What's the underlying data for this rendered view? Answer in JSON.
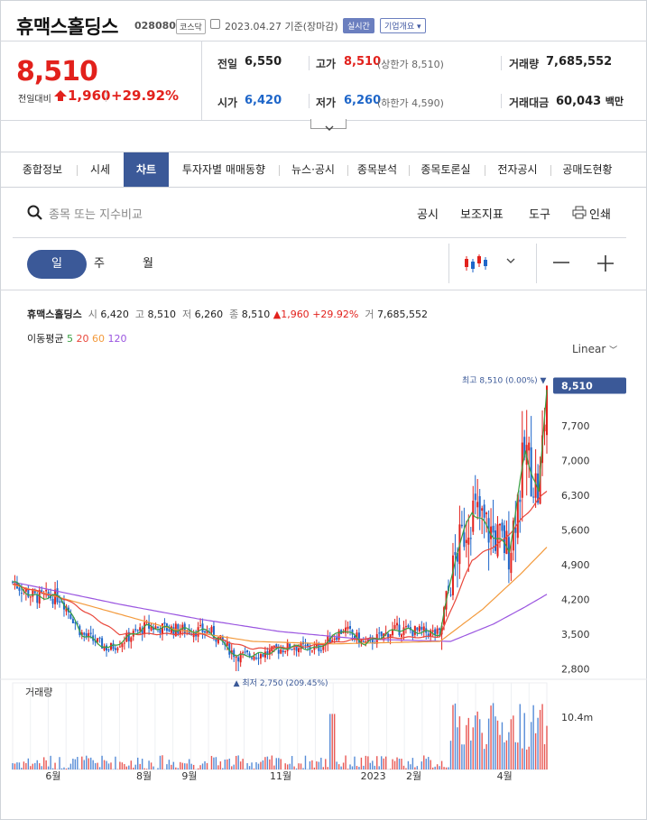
{
  "header": {
    "name": "휴맥스홀딩스",
    "code": "028080",
    "market": "코스닥",
    "date": "2023.04.27",
    "date_suffix": "기준(장마감)",
    "realtime": "실시간",
    "company_overview": "기업개요"
  },
  "price": {
    "current": "8,510",
    "change_label": "전일대비",
    "change": "1,960",
    "change_pct": "+29.92%"
  },
  "quote": {
    "prev_close_label": "전일",
    "prev_close": "6,550",
    "high_label": "고가",
    "high": "8,510",
    "upper_limit": "(상한가 8,510)",
    "volume_label": "거래량",
    "volume": "7,685,552",
    "open_label": "시가",
    "open": "6,420",
    "low_label": "저가",
    "low": "6,260",
    "lower_limit": "(하한가 4,590)",
    "amount_label": "거래대금",
    "amount": "60,043",
    "amount_unit": "백만"
  },
  "tabs": [
    "종합정보",
    "시세",
    "차트",
    "투자자별 매매동향",
    "뉴스·공시",
    "종목분석",
    "종목토론실",
    "전자공시",
    "공매도현황"
  ],
  "toolbar": {
    "search_placeholder": "종목 또는 지수비교",
    "disclosure": "공시",
    "indicator": "보조지표",
    "tools": "도구",
    "print": "인쇄"
  },
  "periods": [
    "일",
    "주",
    "월"
  ],
  "info": {
    "name": "휴맥스홀딩스",
    "open_lbl": "시",
    "open": "6,420",
    "high_lbl": "고",
    "high": "8,510",
    "low_lbl": "저",
    "low": "6,260",
    "close_lbl": "종",
    "close": "8,510",
    "change": "▲1,960",
    "pct": "+29.92%",
    "vol_lbl": "거",
    "vol": "7,685,552"
  },
  "ma": {
    "label": "이동평균",
    "p5": "5",
    "p20": "20",
    "p60": "60",
    "p120": "120"
  },
  "colors": {
    "up": "#e2211c",
    "down": "#1e66c9",
    "accent": "#3b5998",
    "ma5": "#3aa043",
    "ma20": "#e9473b",
    "ma60": "#f39a3c",
    "ma120": "#9a55e0"
  },
  "chart_data": {
    "type": "candlestick",
    "scale": "Linear",
    "y_ticks": [
      "7,700",
      "7,000",
      "6,300",
      "5,600",
      "4,900",
      "4,200",
      "3,500",
      "2,800"
    ],
    "y_tick_values": [
      7700,
      7000,
      6300,
      5600,
      4900,
      4200,
      3500,
      2800
    ],
    "ylim": [
      2550,
      8700
    ],
    "x_ticks": [
      "6월",
      "8월",
      "9월",
      "11월",
      "2023",
      "2월",
      "4월"
    ],
    "x_tick_positions": [
      0.075,
      0.245,
      0.33,
      0.495,
      0.665,
      0.75,
      0.92
    ],
    "current_label": "8,510",
    "current_value": 8510,
    "max_label": "최고 8,510 (0.00%)",
    "max_value": 8510,
    "min_label": "최저 2,750 (209.45%)",
    "min_value": 2750,
    "volume_label": "거래량",
    "volume_tick": "10.4m",
    "price_path_keypoints": [
      [
        0.0,
        4550
      ],
      [
        0.04,
        4250
      ],
      [
        0.09,
        4250
      ],
      [
        0.13,
        3500
      ],
      [
        0.18,
        3200
      ],
      [
        0.25,
        3650
      ],
      [
        0.3,
        3600
      ],
      [
        0.37,
        3550
      ],
      [
        0.42,
        3050
      ],
      [
        0.47,
        3100
      ],
      [
        0.52,
        3250
      ],
      [
        0.57,
        3200
      ],
      [
        0.62,
        3600
      ],
      [
        0.66,
        3300
      ],
      [
        0.72,
        3600
      ],
      [
        0.8,
        3500
      ],
      [
        0.83,
        5100
      ],
      [
        0.86,
        6000
      ],
      [
        0.9,
        5500
      ],
      [
        0.93,
        5200
      ],
      [
        0.96,
        7200
      ],
      [
        0.985,
        6300
      ],
      [
        1.0,
        8510
      ]
    ],
    "ma_series": {
      "ma20_keypoints": [
        [
          0.0,
          4500
        ],
        [
          0.1,
          4200
        ],
        [
          0.2,
          3500
        ],
        [
          0.35,
          3500
        ],
        [
          0.45,
          3200
        ],
        [
          0.55,
          3250
        ],
        [
          0.65,
          3400
        ],
        [
          0.8,
          3450
        ],
        [
          0.86,
          5000
        ],
        [
          0.92,
          5400
        ],
        [
          1.0,
          6400
        ]
      ],
      "ma60_keypoints": [
        [
          0.0,
          4500
        ],
        [
          0.15,
          4050
        ],
        [
          0.3,
          3600
        ],
        [
          0.45,
          3350
        ],
        [
          0.6,
          3300
        ],
        [
          0.8,
          3350
        ],
        [
          0.88,
          4000
        ],
        [
          0.95,
          4700
        ],
        [
          1.0,
          5250
        ]
      ],
      "ma120_keypoints": [
        [
          0.0,
          4550
        ],
        [
          0.2,
          4100
        ],
        [
          0.35,
          3800
        ],
        [
          0.5,
          3550
        ],
        [
          0.65,
          3400
        ],
        [
          0.82,
          3350
        ],
        [
          0.9,
          3700
        ],
        [
          0.96,
          4050
        ],
        [
          1.0,
          4300
        ]
      ]
    }
  }
}
